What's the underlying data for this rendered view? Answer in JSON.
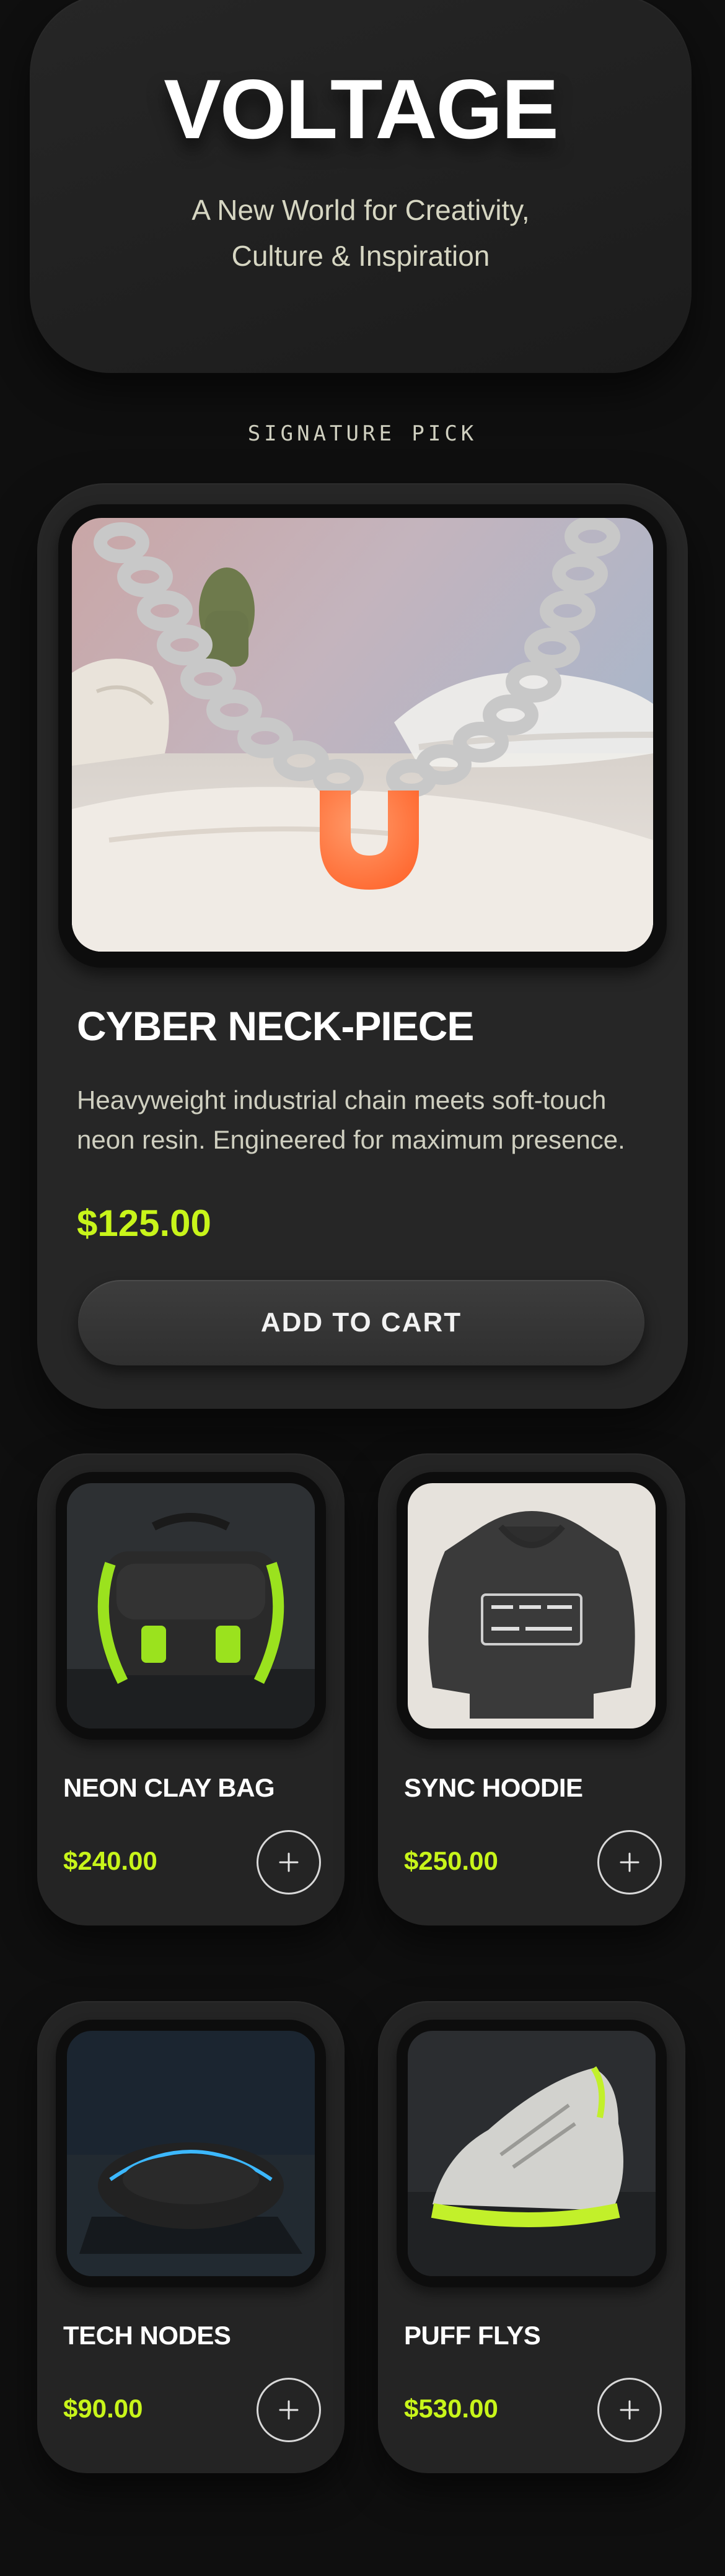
{
  "hero": {
    "title": "VOLTAGE",
    "subtitle_line1": "A New World for Creativity,",
    "subtitle_line2": "Culture & Inspiration"
  },
  "section_label": "SIGNATURE PICK",
  "feature": {
    "name": "CYBER NECK-PIECE",
    "description": "Heavyweight industrial chain meets soft-touch neon resin. Engineered for maximum presence.",
    "price": "$125.00",
    "cta_label": "ADD TO CART"
  },
  "products": [
    {
      "name": "NEON CLAY BAG",
      "price": "$240.00"
    },
    {
      "name": "SYNC HOODIE",
      "price": "$250.00"
    },
    {
      "name": "TECH NODES",
      "price": "$90.00"
    },
    {
      "name": "PUFF FLYS",
      "price": "$530.00"
    }
  ],
  "icons": {
    "add": "plus-icon"
  },
  "colors": {
    "background": "#0f0f0f",
    "card": "#262626",
    "accent": "#c8f51a",
    "text_primary": "#ffffff",
    "text_secondary": "#cfcfc0"
  }
}
